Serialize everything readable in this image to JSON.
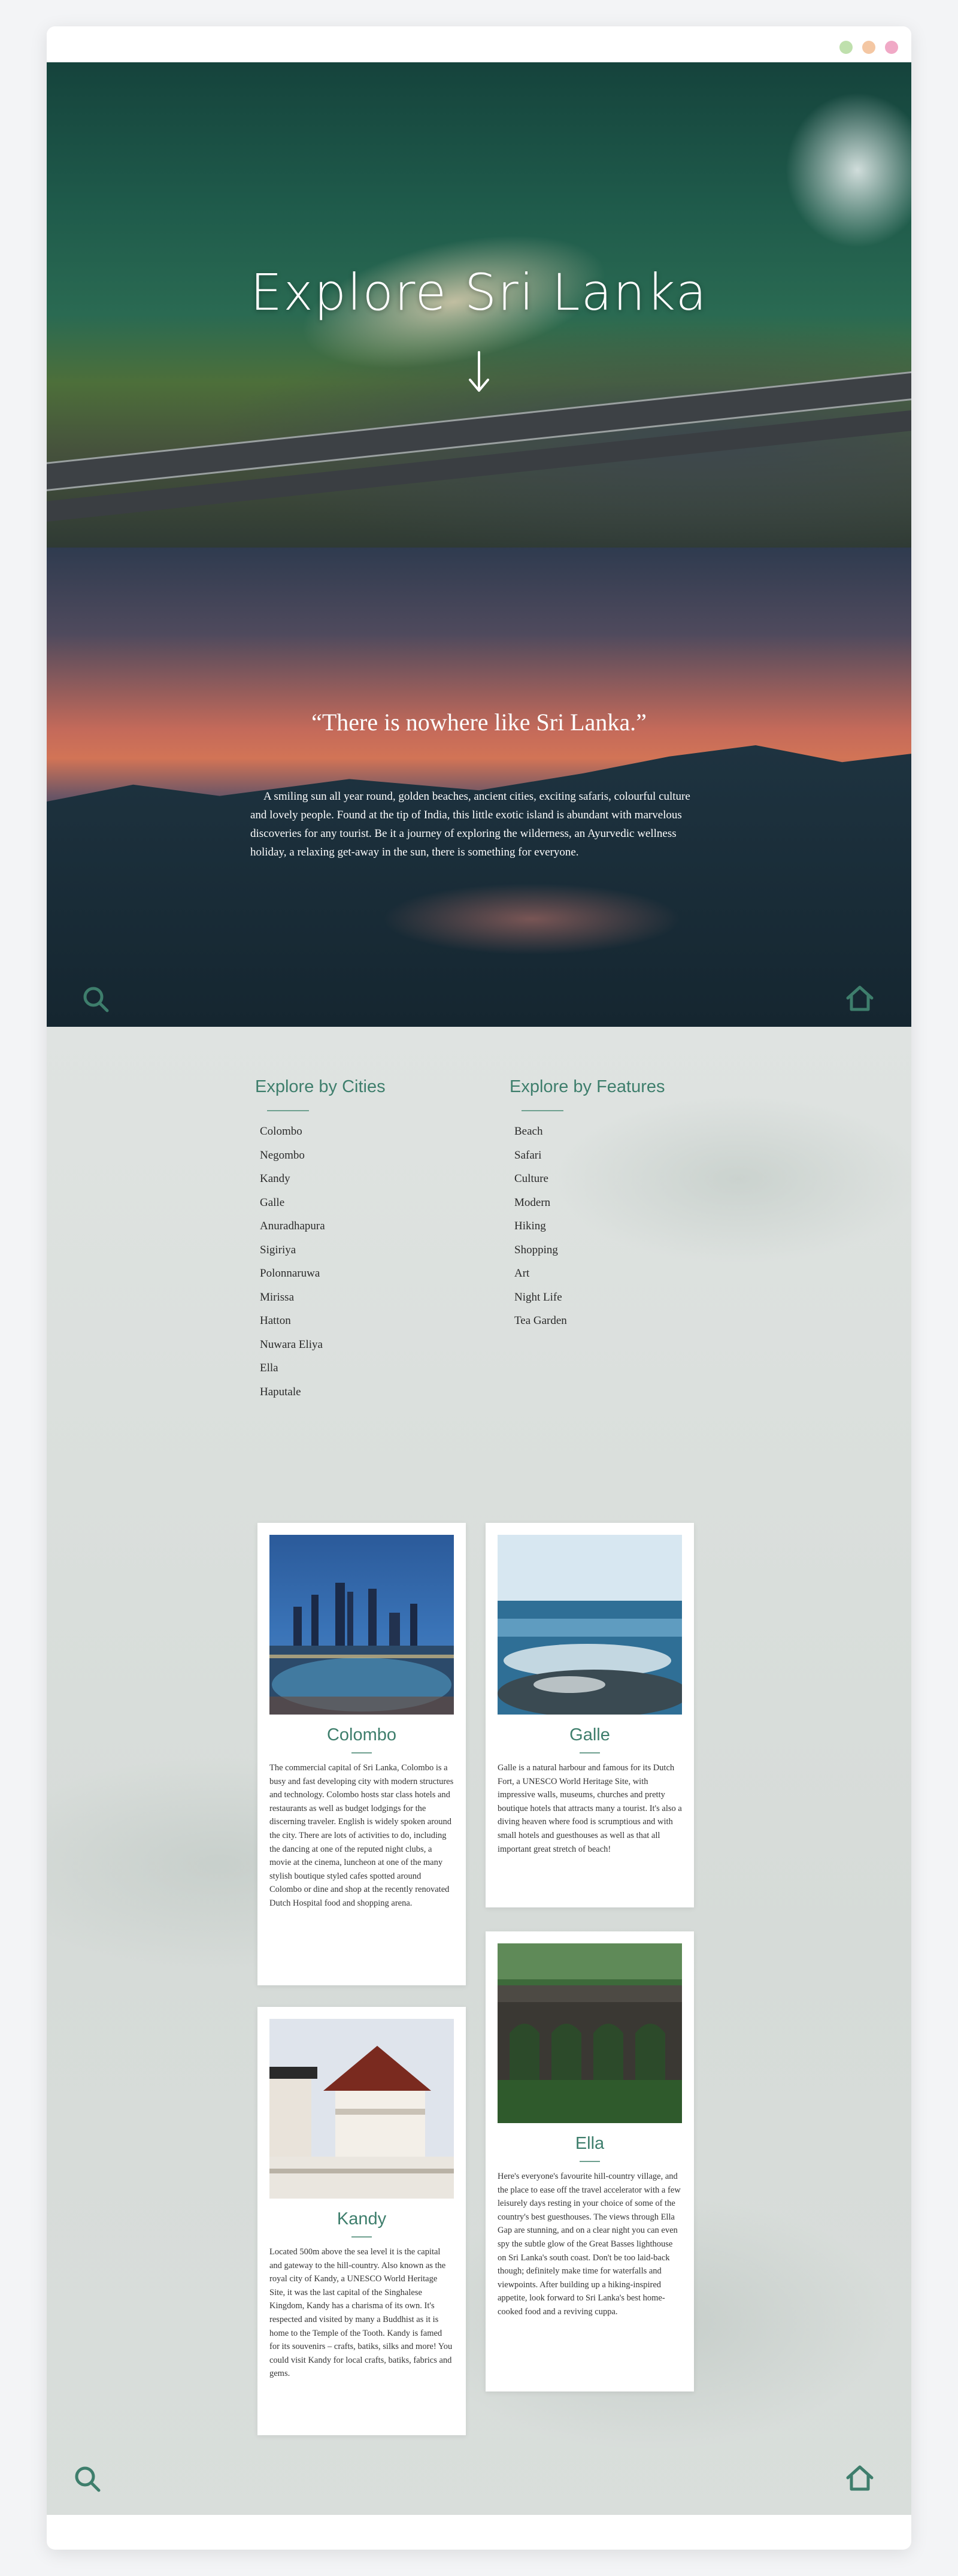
{
  "window_controls": [
    "minimize-dot",
    "maximize-dot",
    "close-dot"
  ],
  "hero": {
    "title": "Explore Sri Lanka",
    "scroll_icon": "arrow-down-icon"
  },
  "intro": {
    "quote": "“There is nowhere like Sri Lanka.”",
    "text": "A smiling sun all year round, golden beaches, ancient cities, exciting safaris, colourful culture and lovely people. Found at the tip of India, this little exotic island is abundant with marvelous discoveries for any tourist. Be it a journey of exploring the wilderness, an Ayurvedic wellness holiday, a relaxing get-away in the sun, there is something for everyone."
  },
  "nav_icons": {
    "search": "search-icon",
    "home": "home-icon",
    "accent": "#3e7e6c"
  },
  "explore": {
    "cities_heading": "Explore by Cities",
    "cities": [
      "Colombo",
      "Negombo",
      "Kandy",
      "Galle",
      "Anuradhapura",
      "Sigiriya",
      "Polonnaruwa",
      "Mirissa",
      "Hatton",
      "Nuwara Eliya",
      "Ella",
      "Haputale"
    ],
    "features_heading": "Explore by Features",
    "features": [
      "Beach",
      "Safari",
      "Culture",
      "Modern",
      "Hiking",
      "Shopping",
      "Art",
      "Night Life",
      "Tea Garden"
    ]
  },
  "cards": [
    {
      "title": "Colombo",
      "text": "The commercial capital of Sri Lanka, Colombo is a busy and fast developing city with modern structures and technology. Colombo hosts star class hotels and restaurants as well as budget lodgings for the discerning traveler. English is widely spoken around the city. There are lots of activities to do, including the dancing at one of the reputed night clubs, a movie at the cinema, luncheon at one of the many stylish boutique styled cafes spotted around Colombo or dine and shop at the recently renovated Dutch Hospital food and shopping arena."
    },
    {
      "title": "Galle",
      "text": "Galle is a natural harbour and famous for its Dutch Fort, a UNESCO World Heritage Site, with impressive walls, museums, churches and pretty boutique hotels that attracts many a tourist. It's also a diving heaven where food is scrumptious and with small hotels and guesthouses as well as that all important great stretch of beach!"
    },
    {
      "title": "Kandy",
      "text": "Located 500m above the sea level it is the capital and gateway to the hill-country. Also known as the royal city of Kandy, a UNESCO World Heritage Site, it was the last capital of the Singhalese Kingdom, Kandy has a charisma of its own. It's respected and visited by many a Buddhist as it is home to the Temple of the Tooth. Kandy is famed for its souvenirs – crafts, batiks, silks and more! You could visit Kandy for local crafts, batiks, fabrics and gems."
    },
    {
      "title": "Ella",
      "text": "Here's everyone's favourite hill-country village, and the place to ease off the travel accelerator with a few leisurely days resting in your choice of some of the country's best guesthouses. The views through Ella Gap are stunning, and on a clear night you can even spy the subtle glow of the Great Basses lighthouse on Sri Lanka's south coast. Don't be too laid-back though; definitely make time for waterfalls and viewpoints. After building up a hiking-inspired appetite, look forward to Sri Lanka's best home-cooked food and a reviving cuppa."
    }
  ]
}
